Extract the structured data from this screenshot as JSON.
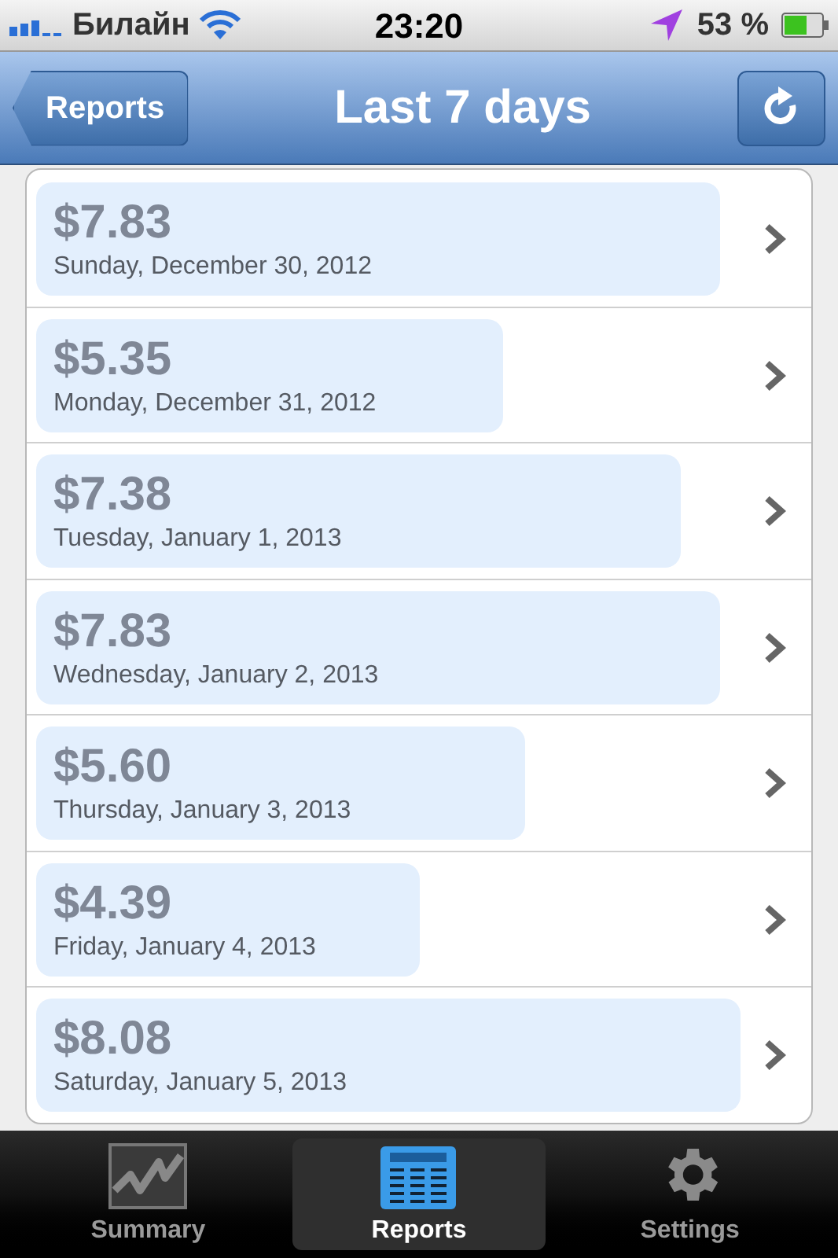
{
  "status_bar": {
    "carrier": "Билайн",
    "time": "23:20",
    "battery": "53 %"
  },
  "nav_bar": {
    "back_button": "Reports",
    "title": "Last 7 days"
  },
  "rows": [
    {
      "amount": "$7.83",
      "date": "Sunday, December 30, 2012"
    },
    {
      "amount": "$5.35",
      "date": "Monday, December 31, 2012"
    },
    {
      "amount": "$7.38",
      "date": "Tuesday, January 1, 2013"
    },
    {
      "amount": "$7.83",
      "date": "Wednesday, January 2, 2013"
    },
    {
      "amount": "$5.60",
      "date": "Thursday, January 3, 2013"
    },
    {
      "amount": "$4.39",
      "date": "Friday, January 4, 2013"
    },
    {
      "amount": "$8.08",
      "date": "Saturday, January 5, 2013"
    }
  ],
  "tab_bar": [
    {
      "kind": "chart",
      "label": "Summary",
      "selected": false
    },
    {
      "kind": "news",
      "label": "Reports",
      "selected": true
    },
    {
      "kind": "gear",
      "label": "Settings",
      "selected": false
    }
  ]
}
